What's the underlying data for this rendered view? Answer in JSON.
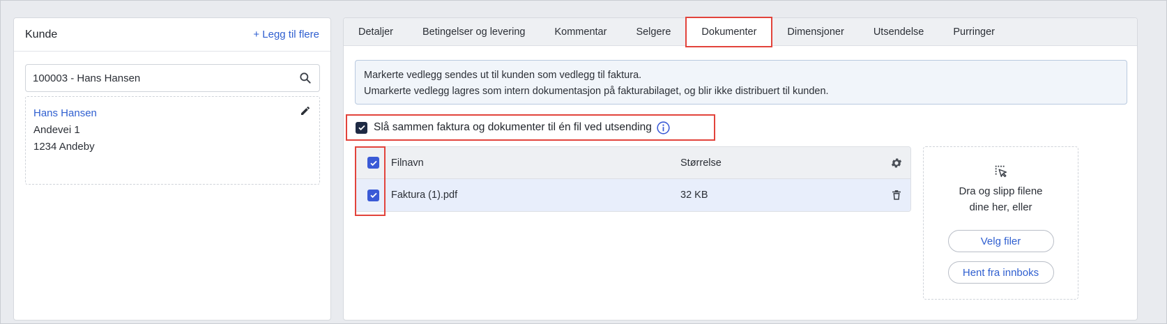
{
  "left": {
    "title": "Kunde",
    "add_more": "+ Legg til flere",
    "search_value": "100003 - Hans Hansen",
    "customer": {
      "name": "Hans Hansen",
      "address": "Andevei 1",
      "postal": "1234 Andeby"
    }
  },
  "tabs": [
    {
      "label": "Detaljer"
    },
    {
      "label": "Betingelser og levering"
    },
    {
      "label": "Kommentar"
    },
    {
      "label": "Selgere"
    },
    {
      "label": "Dokumenter",
      "active": true
    },
    {
      "label": "Dimensjoner"
    },
    {
      "label": "Utsendelse"
    },
    {
      "label": "Purringer"
    }
  ],
  "info": {
    "line1": "Markerte vedlegg sendes ut til kunden som vedlegg til faktura.",
    "line2": "Umarkerte vedlegg lagres som intern dokumentasjon på fakturabilaget, og blir ikke distribuert til kunden."
  },
  "merge": {
    "label": "Slå sammen faktura og dokumenter til én fil ved utsending",
    "checked": true
  },
  "table": {
    "columns": {
      "name": "Filnavn",
      "size": "Størrelse"
    },
    "rows": [
      {
        "name": "Faktura (1).pdf",
        "size": "32 KB",
        "checked": true
      }
    ]
  },
  "dropzone": {
    "text": "Dra og slipp filene dine her, eller",
    "select_files": "Velg filer",
    "from_inbox": "Hent fra innboks"
  },
  "colors": {
    "accent": "#2f5fd0",
    "highlight_border": "#e2433b",
    "checkbox": "#3a5ad6"
  }
}
